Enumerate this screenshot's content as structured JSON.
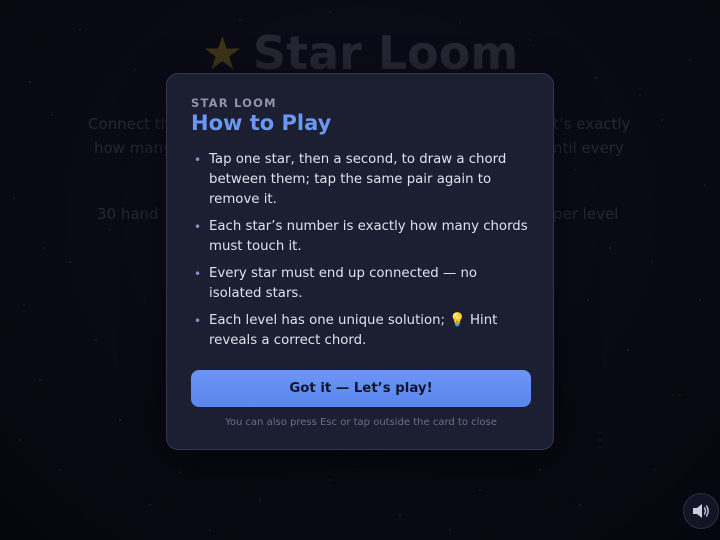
{
  "background": {
    "title": "Star Loom",
    "title_icon": "star-icon",
    "intro_line1_left": "Connect th",
    "intro_line1_right": "t’s exactly",
    "intro_line2_left": "how many",
    "intro_line2_right": "ntil every",
    "levels_left": "30 hand",
    "levels_right": "per level"
  },
  "modal": {
    "eyebrow": "STAR LOOM",
    "title": "How to Play",
    "rules": [
      "Tap one star, then a second, to draw a chord between them; tap the same pair again to remove it.",
      "Each star’s number is exactly how many chords must touch it.",
      "Every star must end up connected — no isolated stars.",
      "Each level has one unique solution; 💡 Hint reveals a correct chord."
    ],
    "cta_label": "Got it — Let’s play!",
    "footnote": "You can also press Esc or tap outside the card to close"
  },
  "controls": {
    "sound_icon": "speaker-icon"
  },
  "colors": {
    "accent": "#6a97f2",
    "button": "#5e8bf0",
    "card_bg": "#1c1e31",
    "page_bg": "#0a0b16"
  }
}
